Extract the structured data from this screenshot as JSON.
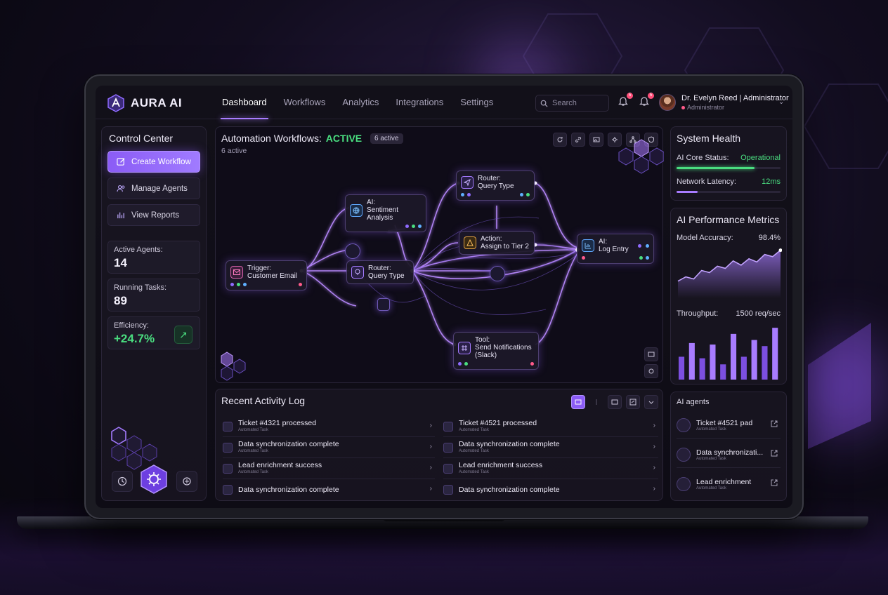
{
  "app": {
    "name": "AURA AI"
  },
  "nav": {
    "items": [
      {
        "label": "Dashboard",
        "active": true
      },
      {
        "label": "Workflows",
        "active": false
      },
      {
        "label": "Analytics",
        "active": false
      },
      {
        "label": "Integrations",
        "active": false
      },
      {
        "label": "Settings",
        "active": false
      }
    ]
  },
  "search": {
    "placeholder": "Search"
  },
  "notifications": {
    "bell1_count": "5",
    "bell2_count": "5"
  },
  "user": {
    "name": "Dr. Evelyn Reed | Administrator",
    "role": "Administrator"
  },
  "control_center": {
    "title": "Control Center",
    "buttons": [
      {
        "label": "Create Workflow",
        "icon": "edit-icon"
      },
      {
        "label": "Manage Agents",
        "icon": "users-icon"
      },
      {
        "label": "View Reports",
        "icon": "bar-chart-icon"
      }
    ],
    "stats": [
      {
        "label": "Active Agents:",
        "value": "14"
      },
      {
        "label": "Running Tasks:",
        "value": "89"
      },
      {
        "label": "Efficiency:",
        "value": "+24.7%"
      }
    ]
  },
  "workflow": {
    "title": "Automation Workflows:",
    "status": "ACTIVE",
    "badge": "6 active",
    "subtitle": "6 active",
    "nodes": {
      "trigger": {
        "line1": "Trigger:",
        "line2": "Customer Email"
      },
      "sentiment": {
        "line1": "AI:",
        "line2": "Sentiment Analysis"
      },
      "router1": {
        "line1": "Router:",
        "line2": "Query Type"
      },
      "router2": {
        "line1": "Router:",
        "line2": "Query Type"
      },
      "action": {
        "line1": "Action:",
        "line2": "Assign to Tier 2"
      },
      "log": {
        "line1": "AI:",
        "line2": "Log Entry"
      },
      "notify": {
        "line1": "Tool:",
        "line2": "Send Notifications (Slack)"
      }
    }
  },
  "activity": {
    "title": "Recent Activity Log",
    "left": [
      {
        "title": "Ticket #4321 processed",
        "sub": "Automated Task"
      },
      {
        "title": "Data synchronization complete",
        "sub": "Automated Task"
      },
      {
        "title": "Lead enrichment success",
        "sub": "Automated Task"
      },
      {
        "title": "Data synchronization complete",
        "sub": ""
      }
    ],
    "right": [
      {
        "title": "Ticket #4521 processed",
        "sub": "Automated Task"
      },
      {
        "title": "Data synchronization complete",
        "sub": "Automated Task"
      },
      {
        "title": "Lead enrichment success",
        "sub": "Automated Task"
      },
      {
        "title": "Data synchronization complete",
        "sub": ""
      }
    ]
  },
  "system_health": {
    "title": "System Health",
    "core_label": "AI Core Status:",
    "core_value": "Operational",
    "core_level": 0.75,
    "latency_label": "Network Latency:",
    "latency_value": "12ms",
    "latency_level": 0.2
  },
  "performance": {
    "title": "AI Performance Metrics",
    "accuracy_label": "Model Accuracy:",
    "accuracy_value": "98.4%",
    "throughput_label": "Throughput:",
    "throughput_value": "1500 req/sec",
    "accuracy_series": [
      32,
      40,
      36,
      52,
      48,
      60,
      56,
      70,
      62,
      74,
      68,
      82,
      78,
      90
    ],
    "throughput_bars": [
      30,
      48,
      28,
      46,
      20,
      60,
      30,
      52,
      44,
      68
    ]
  },
  "agents": {
    "title": "AI agents",
    "items": [
      {
        "name": "Ticket #4521 pad",
        "sub": "Automated Task"
      },
      {
        "name": "Data synchronizati...",
        "sub": "Automated Task"
      },
      {
        "name": "Lead enrichment",
        "sub": "Automated Task"
      }
    ]
  },
  "colors": {
    "accent": "#8b5cf6",
    "success": "#4ade80",
    "background": "#0e0c15"
  }
}
